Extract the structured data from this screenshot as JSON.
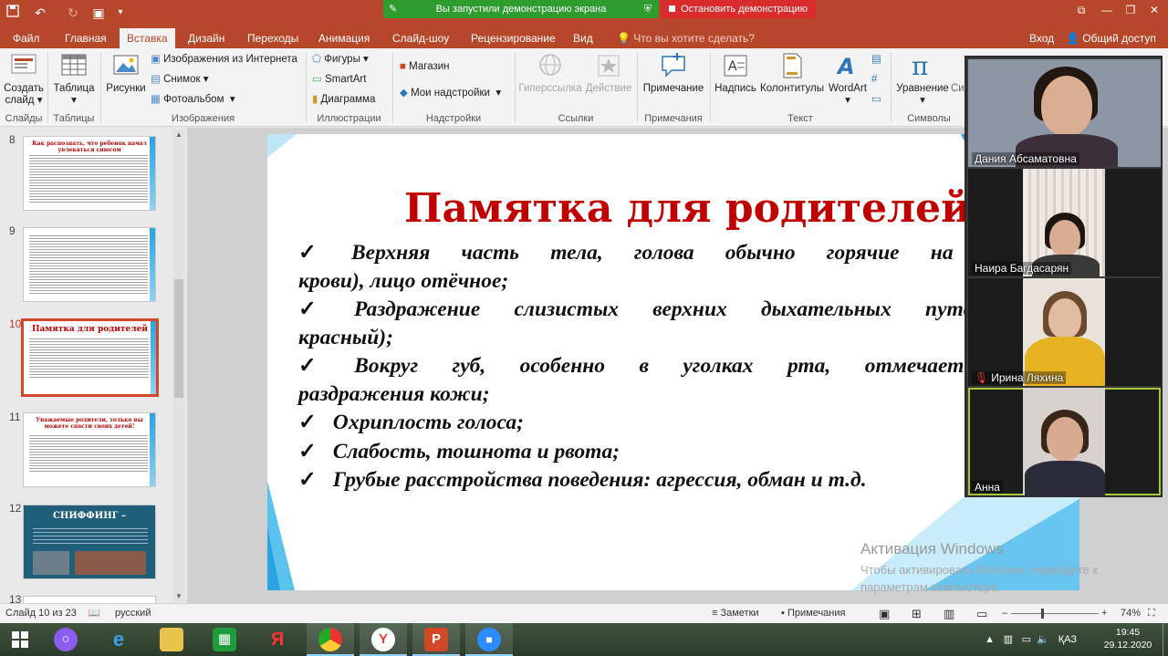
{
  "title_bar": {
    "share_banner": "Вы запустили демонстрацию экрана",
    "stop_button": "Остановить демонстрацию"
  },
  "tabs": [
    "Файл",
    "Главная",
    "Вставка",
    "Дизайн",
    "Переходы",
    "Анимация",
    "Слайд-шоу",
    "Рецензирование",
    "Вид"
  ],
  "active_tab": "Вставка",
  "tell_me": "Что вы хотите сделать?",
  "sign_in": "Вход",
  "share": "Общий доступ",
  "ribbon": {
    "groups": {
      "slides": "Слайды",
      "tables": "Таблицы",
      "images": "Изображения",
      "illustrations": "Иллюстрации",
      "addins": "Надстройки",
      "links": "Ссылки",
      "comments": "Примечания",
      "text": "Текст",
      "symbols": "Символы"
    },
    "new_slide_1": "Создать",
    "new_slide_2": "слайд",
    "table": "Таблица",
    "pictures": "Рисунки",
    "online_pictures": "Изображения из Интернета",
    "screenshot": "Снимок",
    "photo_album": "Фотоальбом",
    "shapes": "Фигуры",
    "smartart": "SmartArt",
    "chart": "Диаграмма",
    "store": "Магазин",
    "my_addins": "Мои надстройки",
    "hyperlink": "Гиперссылка",
    "action": "Действие",
    "comment": "Примечание",
    "textbox": "Надпись",
    "header_footer": "Колонтитулы",
    "wordart": "WordArt",
    "equation": "Уравнение",
    "symbol_partial": "Си"
  },
  "slide_panel": {
    "slides": [
      {
        "num": "8",
        "title": "Как распознать, что ребенок начал увлекаться снюсом"
      },
      {
        "num": "9",
        "title": ""
      },
      {
        "num": "10",
        "title": "Памятка для родителей"
      },
      {
        "num": "11",
        "title": "Уважаемые родители, только вы можете спасти своих детей!"
      },
      {
        "num": "12",
        "title": "СНИФФИНГ –"
      },
      {
        "num": "13",
        "title": ""
      }
    ]
  },
  "slide": {
    "title": "Памятка для родителей",
    "bullets": [
      {
        "l1": "Верхняя часть тела, голова обычно горячие на ощупь (",
        "l2": "крови), лицо отёчное;"
      },
      {
        "l1": "Раздражение слизистых верхних дыхательных путей",
        "l2": "красный);"
      },
      {
        "l1": "Вокруг губ, особенно в уголках рта, отмечается",
        "l2": "раздражения кожи;"
      },
      {
        "l1": "Охриплость голоса;",
        "l2": ""
      },
      {
        "l1": "Слабость, тошнота и рвота;",
        "l2": ""
      },
      {
        "l1": "Грубые расстройства поведения: агрессия, обман и т.д.",
        "l2": ""
      }
    ]
  },
  "watermark": {
    "line1": "Активация Windows",
    "line2": "Чтобы активировать Windows, перейдите к",
    "line3": "параметрам компьютера."
  },
  "participants": [
    {
      "name": "Дания Абсаматовна"
    },
    {
      "name": "Наира Багдасарян"
    },
    {
      "name": "Ирина Ляхина"
    },
    {
      "name": "Анна"
    }
  ],
  "status": {
    "slide_count": "Слайд 10 из 23",
    "language": "русский",
    "notes": "Заметки",
    "comments": "Примечания",
    "zoom": "74%"
  },
  "taskbar": {
    "lang": "ҚАЗ",
    "time": "19:45",
    "date": "29.12.2020"
  },
  "colors": {
    "ppt_accent": "#b7472a",
    "title_red": "#c00000",
    "share_green": "#2e9c2e",
    "stop_red": "#d92c2c"
  }
}
